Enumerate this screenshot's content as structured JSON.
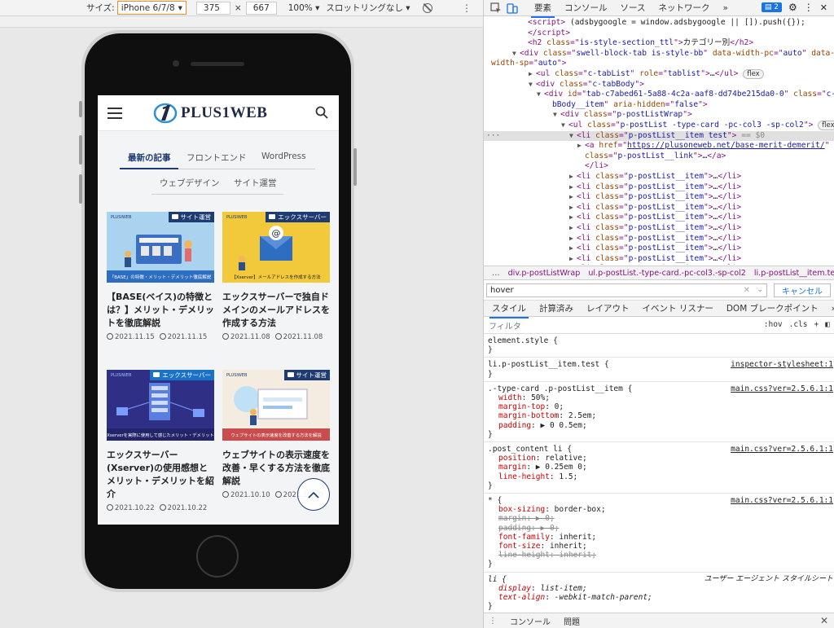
{
  "device_toolbar": {
    "size_label": "サイズ:",
    "device": "iPhone 6/7/8",
    "width": "375",
    "times": "×",
    "height": "667",
    "zoom": "100% ▾",
    "throttle": "スロットリングなし ▾",
    "more": "⋮"
  },
  "site": {
    "logo_text": "PLUS1WEB",
    "tabs": [
      "最新の記事",
      "フロントエンド",
      "WordPress",
      "ウェブデザイン",
      "サイト運営"
    ],
    "posts": [
      {
        "category": "サイト運営",
        "title": "【BASE(ベイス)の特徴とは？】メリット・デメリットを徹底解説",
        "published": "2021.11.15",
        "updated": "2021.11.15",
        "thumb_bg": "#a9d3ee"
      },
      {
        "category": "エックスサーバー",
        "title": "エックスサーバーで独自ドメインのメールアドレスを作成する方法",
        "published": "2021.11.08",
        "updated": "2021.11.08",
        "thumb_bg": "#f1c93a"
      },
      {
        "category": "エックスサーバー",
        "title": "エックスサーバー(Xserver)の使用感想とメリット・デメリットを紹介",
        "published": "2021.10.22",
        "updated": "2021.10.22",
        "thumb_bg": "#2f2f86"
      },
      {
        "category": "サイト運営",
        "title": "ウェブサイトの表示速度を改善・早くする方法を徹底解説",
        "published": "2021.10.10",
        "updated": "2021.10.10",
        "thumb_bg": "#f4ece0"
      }
    ],
    "thumb_captions": [
      "「BASE」の特徴・メリット・デメリット徹底解説",
      "【Xserver】メールアドレスを作成する方法",
      "Xserverを実際に使用して感じたメリット・デメリット",
      "ウェブサイトの表示速度を改善する方法を解説"
    ],
    "brand_small": "PLUSIWEB"
  },
  "devtools": {
    "tabs": [
      "要素",
      "コンソール",
      "ソース",
      "ネットワーク",
      "»"
    ],
    "issues_count": "2",
    "dom_lines": [
      {
        "indent": 5,
        "arrow": "",
        "html": "<span class='tok-tag'>&lt;script&gt;</span><span class='tok-txt'> (adsbygoogle = window.adsbygoogle || []).push({});</span>"
      },
      {
        "indent": 5,
        "arrow": "",
        "html": "<span class='tok-tag'>&lt;/script&gt;</span>"
      },
      {
        "indent": 5,
        "arrow": "",
        "html": "<span class='tok-tag'>&lt;h2 </span><span class='tok-attr'>class</span><span class='tok-tag'>=\"</span><span class='tok-val'>is-style-section_ttl</span><span class='tok-tag'>\"&gt;</span><span class='tok-txt'>カテゴリー別</span><span class='tok-tag'>&lt;/h2&gt;</span>"
      },
      {
        "indent": 4,
        "arrow": "▼",
        "html": "<span class='tok-tag'>&lt;div </span><span class='tok-attr'>class</span><span class='tok-tag'>=\"</span><span class='tok-val'>swell-block-tab is-style-bb</span><span class='tok-tag'>\" </span><span class='tok-attr'>data-width-pc</span><span class='tok-tag'>=\"</span><span class='tok-val'>auto</span><span class='tok-tag'>\" </span><span class='tok-attr'>data-</span>"
      },
      {
        "indent": 0,
        "arrow": "",
        "html": "<span class='tok-attr'>width-sp</span><span class='tok-tag'>=\"</span><span class='tok-val'>auto</span><span class='tok-tag'>\"&gt;</span>"
      },
      {
        "indent": 6,
        "arrow": "▶",
        "html": "<span class='tok-tag'>&lt;ul </span><span class='tok-attr'>class</span><span class='tok-tag'>=\"</span><span class='tok-val'>c-tabList</span><span class='tok-tag'>\" </span><span class='tok-attr'>role</span><span class='tok-tag'>=\"</span><span class='tok-val'>tablist</span><span class='tok-tag'>\"&gt;</span><span class='tok-txt'>…</span><span class='tok-tag'>&lt;/ul&gt;</span> <span class='pill'>flex</span>"
      },
      {
        "indent": 6,
        "arrow": "▼",
        "html": "<span class='tok-tag'>&lt;div </span><span class='tok-attr'>class</span><span class='tok-tag'>=\"</span><span class='tok-val'>c-tabBody</span><span class='tok-tag'>\"&gt;</span>"
      },
      {
        "indent": 7,
        "arrow": "▼",
        "html": "<span class='tok-tag'>&lt;div </span><span class='tok-attr'>id</span><span class='tok-tag'>=\"</span><span class='tok-val'>tab-c7abed61-5a88-4c2a-aaf8-dd74be215da0-0</span><span class='tok-tag'>\" </span><span class='tok-attr'>class</span><span class='tok-tag'>=\"</span><span class='tok-val'>c-ta</span>"
      },
      {
        "indent": 8,
        "arrow": "",
        "html": "<span class='tok-val'>bBody__item</span><span class='tok-tag'>\" </span><span class='tok-attr'>aria-hidden</span><span class='tok-tag'>=\"</span><span class='tok-val'>false</span><span class='tok-tag'>\"&gt;</span>"
      },
      {
        "indent": 9,
        "arrow": "▼",
        "html": "<span class='tok-tag'>&lt;div </span><span class='tok-attr'>class</span><span class='tok-tag'>=\"</span><span class='tok-val'>p-postListWrap</span><span class='tok-tag'>\"&gt;</span>"
      },
      {
        "indent": 10,
        "arrow": "▼",
        "html": "<span class='tok-tag'>&lt;ul </span><span class='tok-attr'>class</span><span class='tok-tag'>=\"</span><span class='tok-val'>p-postList -type-card -pc-col3 -sp-col2</span><span class='tok-tag'>\"&gt;</span> <span class='pill'>flex</span>"
      },
      {
        "indent": 11,
        "arrow": "▼",
        "sel": true,
        "html": "<span class='tok-tag'>&lt;li </span><span class='tok-attr'>class</span><span class='tok-tag'>=\"</span><span class='tok-val'>p-postList__item test</span><span class='tok-tag'>\"&gt;</span><span class='tok-dim'> == $0</span>"
      },
      {
        "indent": 12,
        "arrow": "▶",
        "html": "<span class='tok-tag'>&lt;a </span><span class='tok-attr'>href</span><span class='tok-tag'>=\"</span><span class='tok-link'>https://plusoneweb.net/base-merit-demerit/</span><span class='tok-tag'>\"</span>"
      },
      {
        "indent": 12,
        "arrow": "",
        "html": "<span class='tok-attr'>class</span><span class='tok-tag'>=\"</span><span class='tok-val'>p-postList__link</span><span class='tok-tag'>\"&gt;</span><span class='tok-txt'>…</span><span class='tok-tag'>&lt;/a&gt;</span>"
      },
      {
        "indent": 12,
        "arrow": "",
        "html": "<span class='tok-tag'>&lt;/li&gt;</span>"
      },
      {
        "indent": 11,
        "arrow": "▶",
        "html": "<span class='tok-tag'>&lt;li </span><span class='tok-attr'>class</span><span class='tok-tag'>=\"</span><span class='tok-val'>p-postList__item</span><span class='tok-tag'>\"&gt;</span><span class='tok-txt'>…</span><span class='tok-tag'>&lt;/li&gt;</span>"
      },
      {
        "indent": 11,
        "arrow": "▶",
        "html": "<span class='tok-tag'>&lt;li </span><span class='tok-attr'>class</span><span class='tok-tag'>=\"</span><span class='tok-val'>p-postList__item</span><span class='tok-tag'>\"&gt;</span><span class='tok-txt'>…</span><span class='tok-tag'>&lt;/li&gt;</span>"
      },
      {
        "indent": 11,
        "arrow": "▶",
        "html": "<span class='tok-tag'>&lt;li </span><span class='tok-attr'>class</span><span class='tok-tag'>=\"</span><span class='tok-val'>p-postList__item</span><span class='tok-tag'>\"&gt;</span><span class='tok-txt'>…</span><span class='tok-tag'>&lt;/li&gt;</span>"
      },
      {
        "indent": 11,
        "arrow": "▶",
        "html": "<span class='tok-tag'>&lt;li </span><span class='tok-attr'>class</span><span class='tok-tag'>=\"</span><span class='tok-val'>p-postList__item</span><span class='tok-tag'>\"&gt;</span><span class='tok-txt'>…</span><span class='tok-tag'>&lt;/li&gt;</span>"
      },
      {
        "indent": 11,
        "arrow": "▶",
        "html": "<span class='tok-tag'>&lt;li </span><span class='tok-attr'>class</span><span class='tok-tag'>=\"</span><span class='tok-val'>p-postList__item</span><span class='tok-tag'>\"&gt;</span><span class='tok-txt'>…</span><span class='tok-tag'>&lt;/li&gt;</span>"
      },
      {
        "indent": 11,
        "arrow": "▶",
        "html": "<span class='tok-tag'>&lt;li </span><span class='tok-attr'>class</span><span class='tok-tag'>=\"</span><span class='tok-val'>p-postList__item</span><span class='tok-tag'>\"&gt;</span><span class='tok-txt'>…</span><span class='tok-tag'>&lt;/li&gt;</span>"
      },
      {
        "indent": 11,
        "arrow": "▶",
        "html": "<span class='tok-tag'>&lt;li </span><span class='tok-attr'>class</span><span class='tok-tag'>=\"</span><span class='tok-val'>p-postList__item</span><span class='tok-tag'>\"&gt;</span><span class='tok-txt'>…</span><span class='tok-tag'>&lt;/li&gt;</span>"
      },
      {
        "indent": 11,
        "arrow": "▶",
        "html": "<span class='tok-tag'>&lt;li </span><span class='tok-attr'>class</span><span class='tok-tag'>=\"</span><span class='tok-val'>p-postList__item</span><span class='tok-tag'>\"&gt;</span><span class='tok-txt'>…</span><span class='tok-tag'>&lt;/li&gt;</span>"
      },
      {
        "indent": 11,
        "arrow": "▶",
        "html": "<span class='tok-tag'>&lt;li </span><span class='tok-attr'>class</span><span class='tok-tag'>=\"</span><span class='tok-val'>p-postList__item</span><span class='tok-tag'>\"&gt;</span><span class='tok-txt'>…</span><span class='tok-tag'>&lt;/li&gt;</span>"
      },
      {
        "indent": 11,
        "arrow": "▶",
        "html": "<span class='tok-tag'>&lt;li </span><span class='tok-attr'>class</span><span class='tok-tag'>=\"</span><span class='tok-val'>p-postList__item</span><span class='tok-tag'>\"&gt;</span><span class='tok-txt'>…</span><span class='tok-tag'>&lt;/li&gt;</span>"
      }
    ],
    "breadcrumb": [
      "…",
      "div.p-postListWrap",
      "ul.p-postList.-type-card.-pc-col3.-sp-col2",
      "li.p-postList__item.test"
    ],
    "hover_filter": "hover",
    "cancel": "キャンセル",
    "style_tabs": [
      "スタイル",
      "計算済み",
      "レイアウト",
      "イベント リスナー",
      "DOM ブレークポイント",
      "»"
    ],
    "styles_filter_placeholder": "フィルタ",
    "hov": ":hov",
    "cls": ".cls",
    "rules": [
      {
        "selector": "element.style {",
        "source": "",
        "props": []
      },
      {
        "selector": "li.p-postList__item.test {",
        "source": "inspector-stylesheet:1",
        "props": []
      },
      {
        "selector": ".-type-card .p-postList__item {",
        "source": "main.css?ver=2.5.6.1:1",
        "props": [
          {
            "name": "width",
            "value": "50%;"
          },
          {
            "name": "margin-top",
            "value": "0;"
          },
          {
            "name": "margin-bottom",
            "value": "2.5em;"
          },
          {
            "name": "padding",
            "value": "▶ 0 0.5em;"
          }
        ]
      },
      {
        "selector": ".post_content li {",
        "source": "main.css?ver=2.5.6.1:1",
        "props": [
          {
            "name": "position",
            "value": "relative;"
          },
          {
            "name": "margin",
            "value": "▶ 0.25em 0;"
          },
          {
            "name": "line-height",
            "value": "1.5;"
          }
        ]
      },
      {
        "selector": "* {",
        "source": "main.css?ver=2.5.6.1:1",
        "props": [
          {
            "name": "box-sizing",
            "value": "border-box;"
          },
          {
            "name": "margin",
            "value": "▶ 0;",
            "strike": true
          },
          {
            "name": "padding",
            "value": "▶ 0;",
            "strike": true
          },
          {
            "name": "font-family",
            "value": "inherit;"
          },
          {
            "name": "font-size",
            "value": "inherit;"
          },
          {
            "name": "line-height",
            "value": "inherit;",
            "strike": true
          }
        ]
      },
      {
        "selector": "li {",
        "source": "ユーザー エージェント スタイルシート",
        "italic": true,
        "props": [
          {
            "name": "display",
            "value": "list-item;"
          },
          {
            "name": "text-align",
            "value": "-webkit-match-parent;"
          }
        ]
      }
    ],
    "drawer_tabs": [
      "コンソール",
      "問題"
    ],
    "close_icon": "✕"
  }
}
